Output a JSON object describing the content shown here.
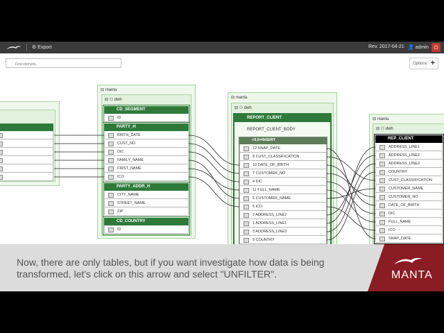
{
  "topbar": {
    "export": "Export",
    "revision": "Rev. 2017-04-21",
    "user": "admin"
  },
  "search": {
    "placeholder": "Find element..."
  },
  "options": {
    "label": "Options"
  },
  "packages": {
    "left": {
      "label": "manta",
      "schema": "dwh"
    },
    "mid": {
      "label": "manta",
      "schema": "dwh"
    },
    "right": {
      "label": "manta",
      "schema": "dwh"
    }
  },
  "tables": {
    "cd_segment": {
      "title": "CD_SEGMENT",
      "rows": [
        "ID"
      ]
    },
    "party_h": {
      "title": "PARTY_H",
      "rows": [
        "BIRTH_DATE",
        "CUST_NO",
        "DIC",
        "FAMILY_NAME",
        "FIRST_NAME",
        "ICO"
      ]
    },
    "party_addr_h": {
      "title": "PARTY_ADDR_H",
      "rows": [
        "CITY_NAME",
        "STREET_NAME",
        "ZIP"
      ]
    },
    "cd_country": {
      "title": "CD_COUNTRY",
      "rows": [
        "ID"
      ]
    },
    "report_client": {
      "title": "REPORT_CLIENT",
      "body": "REPORT_CLIENT_BODY",
      "insert": "<9,9>INSERT",
      "rows": [
        "12 SNAP_DATE",
        "8 CUST_CLASSIFICATION",
        "10 DATE_OF_BIRTH",
        "7 CUSTOMER_NO",
        "4 DIC",
        "11 FULL_NAME",
        "6 CUSTOMER_NAME",
        "5 ICO",
        "2 ADDRESS_LINE2",
        "1 ADDRESS_LINE1",
        "3 ADDRESS_LINE3",
        "9 COUNTRY"
      ]
    },
    "rep_client": {
      "title": "REP_CLIENT",
      "rows": [
        "ADDRESS_LINE1",
        "ADDRESS_LINE2",
        "ADDRESS_LINE3",
        "COUNTRY",
        "CUST_CLASSIFICATION",
        "CUSTOMER_NAME",
        "CUSTOMER_NO",
        "DATE_OF_BIRTH",
        "DIC",
        "FULL_NAME",
        "ICO",
        "SNAP_DATE"
      ]
    }
  },
  "caption": {
    "text": "Now, there are only tables, but if you want investigate how data is being transformed, let's click on this arrow and select \"UNFILTER\".",
    "brand": "MANTA"
  },
  "colors": {
    "accent": "#2f7a3a",
    "brand": "#8a1c24",
    "topbar": "#3a3a3a"
  }
}
